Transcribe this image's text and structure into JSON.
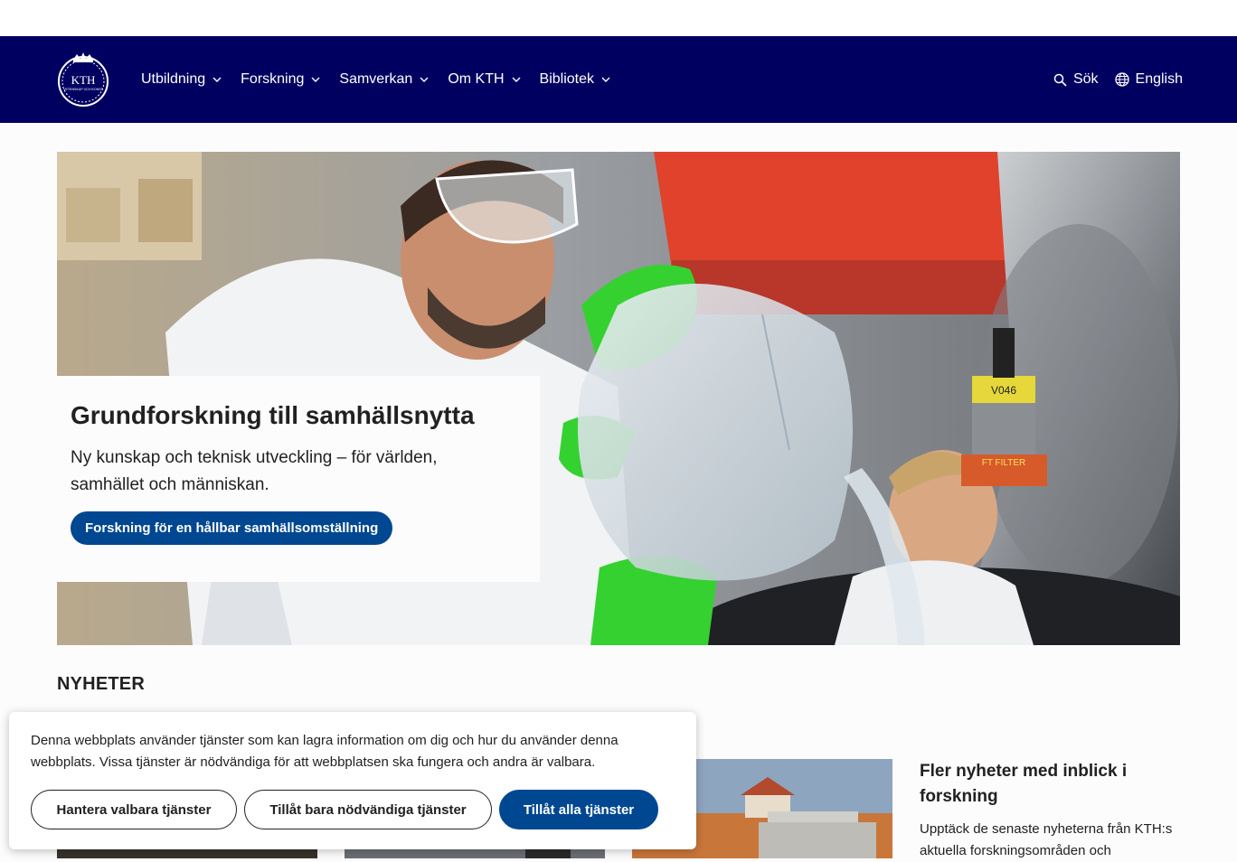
{
  "header": {
    "logo_text": "KTH",
    "logo_subtext": "VETENSKAP OCH KONST",
    "menu": [
      {
        "label": "Utbildning",
        "icon": "chevron-down-icon"
      },
      {
        "label": "Forskning",
        "icon": "chevron-down-icon"
      },
      {
        "label": "Samverkan",
        "icon": "chevron-down-icon"
      },
      {
        "label": "Om KTH",
        "icon": "chevron-down-icon"
      },
      {
        "label": "Bibliotek",
        "icon": "chevron-down-icon"
      }
    ],
    "search_label": "Sök",
    "language_label": "English"
  },
  "hero": {
    "title": "Grundforskning till samhällsnytta",
    "text": "Ny kunskap och teknisk utveckling – för världen, samhället och människan.",
    "button_label": "Forskning för en hållbar samhällsomställning",
    "image_labels": [
      "V046",
      "FT FILTER"
    ]
  },
  "news": {
    "heading": "NYHETER",
    "side_title": "Fler nyheter med inblick i forskning",
    "side_text": "Upptäck de senaste nyheterna från KTH:s aktuella forskningsområden och"
  },
  "cookie": {
    "text": "Denna webbplats använder tjänster som kan lagra information om dig och hur du använder denna webbplats. Vissa tjänster är nödvändiga för att webbplatsen ska fungera och andra är valbara.",
    "manage_label": "Hantera valbara tjänster",
    "necessary_label": "Tillåt bara nödvändiga tjänster",
    "accept_all_label": "Tillåt alla tjänster"
  },
  "colors": {
    "nav_bg": "#000061",
    "primary_button": "#004791"
  }
}
